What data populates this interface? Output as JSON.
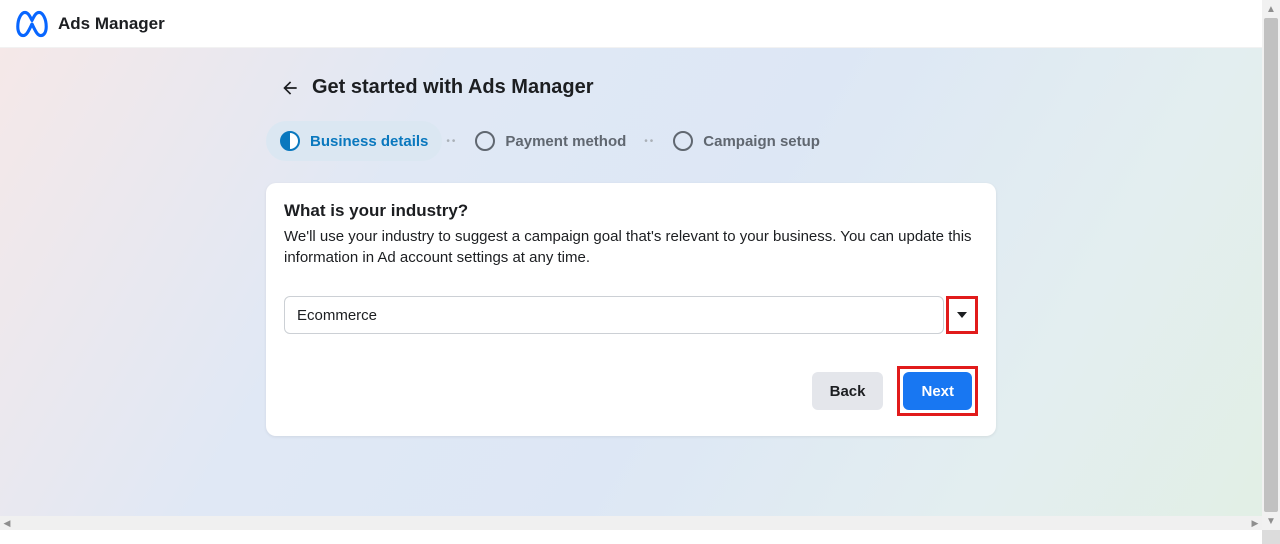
{
  "header": {
    "app_title": "Ads Manager"
  },
  "page": {
    "title": "Get started with Ads Manager"
  },
  "stepper": {
    "steps": [
      {
        "label": "Business details",
        "state": "active"
      },
      {
        "label": "Payment method",
        "state": "inactive"
      },
      {
        "label": "Campaign setup",
        "state": "inactive"
      }
    ]
  },
  "card": {
    "heading": "What is your industry?",
    "description": "We'll use your industry to suggest a campaign goal that's relevant to your business. You can update this information in Ad account settings at any time.",
    "select_value": "Ecommerce"
  },
  "buttons": {
    "back": "Back",
    "next": "Next"
  }
}
